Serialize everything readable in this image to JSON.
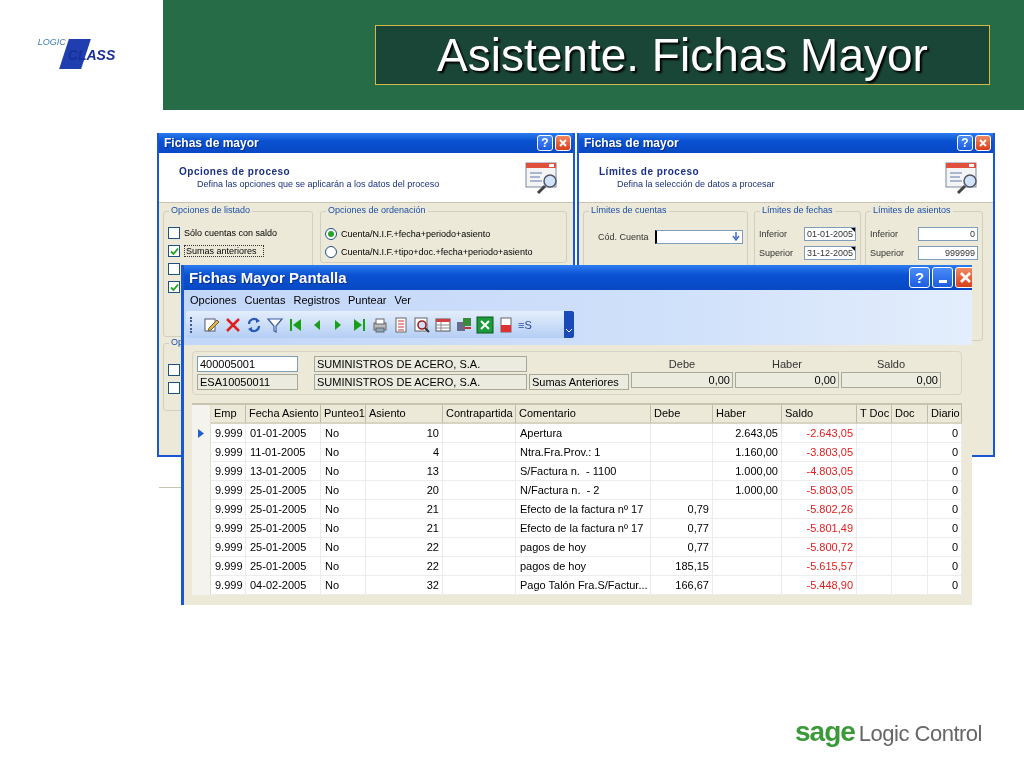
{
  "slide": {
    "title": "Asistente. Fichas Mayor",
    "logo_top": {
      "word_1": "LOGIC",
      "word_2": "CLASS"
    },
    "logo_bottom": {
      "brand": "sage",
      "product": "Logic Control"
    }
  },
  "wizard_left": {
    "title": "Fichas de mayor",
    "help_button": "?",
    "heading": "Opciones de proceso",
    "subheading": "Defina las opciones que se aplicarán a los datos del proceso",
    "listing_group": {
      "label": "Opciones de listado",
      "options": [
        {
          "label": "Sólo cuentas con saldo",
          "checked": false
        },
        {
          "label": "Sumas anteriores",
          "checked": true,
          "focused": true
        },
        {
          "checked": false
        },
        {
          "checked": true
        }
      ]
    },
    "sort_group": {
      "label": "Opciones de ordenación",
      "options": [
        {
          "label": "Cuenta/N.I.F.+fecha+periodo+asiento",
          "selected": true
        },
        {
          "label": "Cuenta/N.I.F.+tipo+doc.+fecha+periodo+asiento",
          "selected": false
        }
      ]
    },
    "group_3": {
      "label": "Op",
      "options": [
        {
          "checked": false
        },
        {
          "checked": false
        }
      ]
    }
  },
  "wizard_right": {
    "title": "Fichas de mayor",
    "help_button": "?",
    "heading": "Límites de proceso",
    "subheading": "Defina la selección de datos a procesar",
    "accounts_group": {
      "label": "Límites de cuentas",
      "field_label": "Cód. Cuenta"
    },
    "dates_group": {
      "label": "Límites de fechas",
      "lower_label": "Inferior",
      "lower": "01-01-2005",
      "upper_label": "Superior",
      "upper": "31-12-2005"
    },
    "entries_group": {
      "label": "Límites de asientos",
      "lower_label": "Inferior",
      "lower": "0",
      "upper_label": "Superior",
      "upper": "999999"
    }
  },
  "ledger_window": {
    "title": "Fichas Mayor Pantalla",
    "help_button": "?",
    "menu": [
      "Opciones",
      "Cuentas",
      "Registros",
      "Puntear",
      "Ver"
    ],
    "toolbar_sum_button": "≡S",
    "account": {
      "code": "400005001",
      "name": "SUMINISTROS DE ACERO, S.A.",
      "nif": "ESA10050011",
      "nif_name": "SUMINISTROS DE ACERO, S.A."
    },
    "totals": {
      "label": "Sumas Anteriores",
      "columns": [
        "Debe",
        "Haber",
        "Saldo"
      ],
      "values": [
        "0,00",
        "0,00",
        "0,00"
      ]
    },
    "table": {
      "columns": [
        "Emp",
        "Fecha Asiento",
        "Punteo1",
        "Asiento",
        "Contrapartida",
        "Comentario",
        "Debe",
        "Haber",
        "Saldo",
        "T Doc",
        "Doc",
        "Diario"
      ],
      "rows": [
        {
          "current": true,
          "emp": "9.999",
          "fecha": "01-01-2005",
          "punteo": "No",
          "asiento": "10",
          "comentario": "Apertura",
          "haber": "2.643,05",
          "saldo": "-2.643,05",
          "diario": "0"
        },
        {
          "current": false,
          "emp": "9.999",
          "fecha": "11-01-2005",
          "punteo": "No",
          "asiento": "4",
          "comentario": "Ntra.Fra.Prov.: 1",
          "haber": "1.160,00",
          "saldo": "-3.803,05",
          "diario": "0"
        },
        {
          "current": false,
          "emp": "9.999",
          "fecha": "13-01-2005",
          "punteo": "No",
          "asiento": "13",
          "comentario": "S/Factura n.  - 1100",
          "haber": "1.000,00",
          "saldo": "-4.803,05",
          "diario": "0"
        },
        {
          "current": false,
          "emp": "9.999",
          "fecha": "25-01-2005",
          "punteo": "No",
          "asiento": "20",
          "comentario": "N/Factura n.  - 2",
          "haber": "1.000,00",
          "saldo": "-5.803,05",
          "diario": "0"
        },
        {
          "current": false,
          "emp": "9.999",
          "fecha": "25-01-2005",
          "punteo": "No",
          "asiento": "21",
          "comentario": "Efecto de la factura nº 17",
          "debe": "0,79",
          "saldo": "-5.802,26",
          "diario": "0"
        },
        {
          "current": false,
          "emp": "9.999",
          "fecha": "25-01-2005",
          "punteo": "No",
          "asiento": "21",
          "comentario": "Efecto de la factura nº 17",
          "debe": "0,77",
          "saldo": "-5.801,49",
          "diario": "0"
        },
        {
          "current": false,
          "emp": "9.999",
          "fecha": "25-01-2005",
          "punteo": "No",
          "asiento": "22",
          "comentario": "pagos de hoy",
          "debe": "0,77",
          "saldo": "-5.800,72",
          "diario": "0"
        },
        {
          "current": false,
          "emp": "9.999",
          "fecha": "25-01-2005",
          "punteo": "No",
          "asiento": "22",
          "comentario": "pagos de hoy",
          "debe": "185,15",
          "saldo": "-5.615,57",
          "diario": "0"
        },
        {
          "current": false,
          "emp": "9.999",
          "fecha": "04-02-2005",
          "punteo": "No",
          "asiento": "32",
          "comentario": "Pago Talón Fra.S/Factur...",
          "debe": "166,67",
          "saldo": "-5.448,90",
          "diario": "0"
        }
      ]
    }
  }
}
